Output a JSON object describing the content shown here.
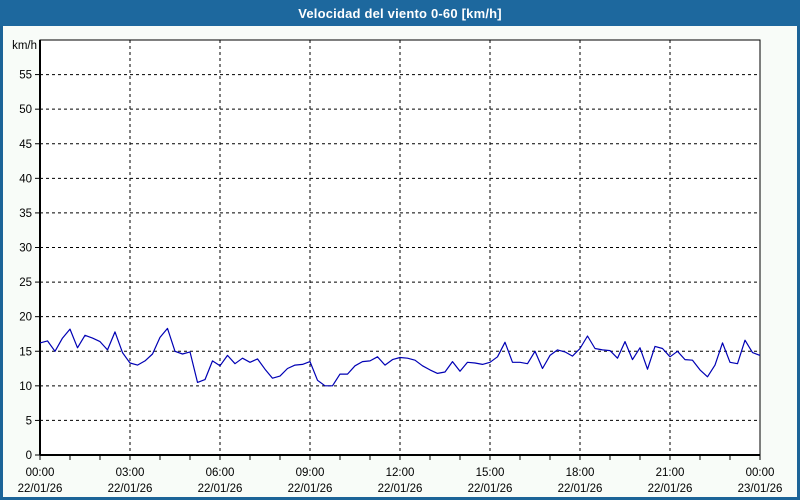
{
  "window": {
    "title": "Velocidad del viento 0-60 [km/h]"
  },
  "colors": {
    "titlebar_bg": "#1d689e",
    "titlebar_text": "#ffffff",
    "frame_border": "#1c6498",
    "content_bg": "#f8fcf8",
    "plot_bg": "#ffffff",
    "axis": "#000000",
    "grid": "#000000",
    "line": "#0000b4",
    "label": "#000000"
  },
  "chart_data": {
    "type": "line",
    "title": "Velocidad del viento 0-60 [km/h]",
    "ylabel": "km/h",
    "xlabel": "",
    "ylim": [
      0,
      60
    ],
    "ytick_step": 5,
    "ytick_labels": [
      "0",
      "5",
      "10",
      "15",
      "20",
      "25",
      "30",
      "35",
      "40",
      "45",
      "50",
      "55"
    ],
    "xlim_hours": [
      0,
      24
    ],
    "x_major_step_hours": 3,
    "x_minor_step_hours": 1,
    "grid": "dashed",
    "legend": "none",
    "xticks": [
      {
        "time": "00:00",
        "date": "22/01/26"
      },
      {
        "time": "03:00",
        "date": "22/01/26"
      },
      {
        "time": "06:00",
        "date": "22/01/26"
      },
      {
        "time": "09:00",
        "date": "22/01/26"
      },
      {
        "time": "12:00",
        "date": "22/01/26"
      },
      {
        "time": "15:00",
        "date": "22/01/26"
      },
      {
        "time": "18:00",
        "date": "22/01/26"
      },
      {
        "time": "21:00",
        "date": "22/01/26"
      },
      {
        "time": "00:00",
        "date": "23/01/26"
      }
    ],
    "series": [
      {
        "name": "Velocidad del viento",
        "x_start_hours": 0,
        "x_step_hours": 0.25,
        "values": [
          16.2,
          16.5,
          15.0,
          16.9,
          18.2,
          15.5,
          17.3,
          16.9,
          16.4,
          15.2,
          17.8,
          14.8,
          13.3,
          13.0,
          13.6,
          14.6,
          17.0,
          18.3,
          15.0,
          14.6,
          14.9,
          10.5,
          10.9,
          13.6,
          12.9,
          14.4,
          13.2,
          14.0,
          13.4,
          13.9,
          12.4,
          11.1,
          11.4,
          12.5,
          13.0,
          13.1,
          13.5,
          10.8,
          10.0,
          10.0,
          11.7,
          11.7,
          12.9,
          13.5,
          13.6,
          14.2,
          13.0,
          13.8,
          14.1,
          14.0,
          13.7,
          12.9,
          12.3,
          11.8,
          12.0,
          13.5,
          12.1,
          13.4,
          13.3,
          13.1,
          13.4,
          14.2,
          16.3,
          13.4,
          13.4,
          13.2,
          15.0,
          12.5,
          14.4,
          15.2,
          14.9,
          14.3,
          15.4,
          17.2,
          15.4,
          15.2,
          15.1,
          14.0,
          16.4,
          13.8,
          15.5,
          12.4,
          15.7,
          15.4,
          14.2,
          15.0,
          13.8,
          13.7,
          12.3,
          11.3,
          13.0,
          16.2,
          13.4,
          13.2,
          16.6,
          14.8,
          14.4
        ]
      }
    ]
  }
}
